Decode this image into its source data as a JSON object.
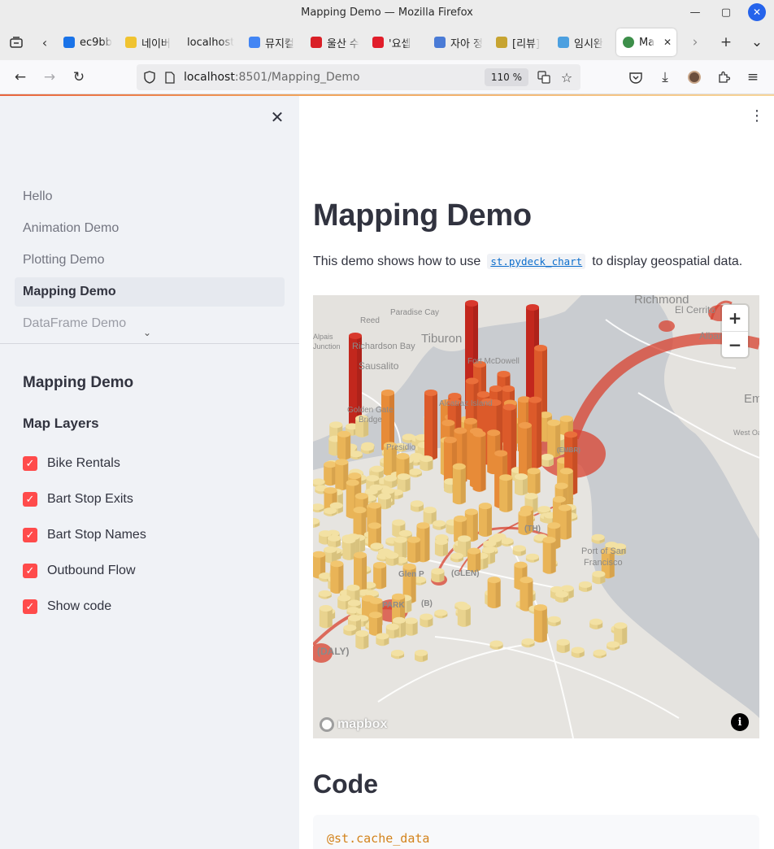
{
  "window": {
    "title": "Mapping Demo — Mozilla Firefox"
  },
  "tabs": [
    {
      "label": "ec9bb",
      "favicon_color": "#1a73e8",
      "icon": "search-icon"
    },
    {
      "label": "네이버",
      "favicon_color": "#f0c330",
      "icon": "naver-icon"
    },
    {
      "label": "localhost",
      "favicon_color": "",
      "icon": ""
    },
    {
      "label": "뮤지컬",
      "favicon_color": "#4285f4",
      "icon": "google-icon"
    },
    {
      "label": "울산 수",
      "favicon_color": "#d91f26",
      "icon": "swoosh-icon"
    },
    {
      "label": "'요셉",
      "favicon_color": "#e11d2a",
      "icon": "flag-icon"
    },
    {
      "label": "자아 정",
      "favicon_color": "#4a7bd6",
      "icon": "doc-icon"
    },
    {
      "label": "[리뷰]",
      "favicon_color": "#c7a431",
      "icon": "bookmark-icon"
    },
    {
      "label": "임시완",
      "favicon_color": "#4ca0e0",
      "icon": "cloud-icon"
    },
    {
      "label": "Ma",
      "favicon_color": "#3d8f4a",
      "icon": "globe-icon",
      "active": true
    }
  ],
  "navbar": {
    "url_host": "localhost",
    "url_rest": ":8501/Mapping_Demo",
    "zoom": "110 %"
  },
  "sidebar": {
    "nav_items": [
      {
        "label": "Hello"
      },
      {
        "label": "Animation Demo"
      },
      {
        "label": "Plotting Demo"
      },
      {
        "label": "Mapping Demo"
      },
      {
        "label": "DataFrame Demo"
      }
    ],
    "section_title": "Mapping Demo",
    "layers_title": "Map Layers",
    "layers": [
      {
        "label": "Bike Rentals",
        "checked": true
      },
      {
        "label": "Bart Stop Exits",
        "checked": true
      },
      {
        "label": "Bart Stop Names",
        "checked": true
      },
      {
        "label": "Outbound Flow",
        "checked": true
      },
      {
        "label": "Show code",
        "checked": true
      }
    ]
  },
  "main": {
    "title": "Mapping Demo",
    "desc_before": "This demo shows how to use",
    "desc_code": "st.pydeck_chart",
    "desc_after": "to display geospatial data.",
    "code_title": "Code",
    "code_first_line": "@st.cache_data"
  },
  "map": {
    "places": [
      "Richmond",
      "Paradise Cay",
      "Reed",
      "Tiburon",
      "Richardson Bay",
      "Sausalito",
      "Fort McDowell",
      "Golden Gate",
      "Bridge",
      "Alcatraz Island",
      "Port of San",
      "Francisco",
      "El Cerrito",
      "Albany",
      "Emeryville",
      "West Oakland",
      "Junction",
      "Alpais",
      "(DALY)",
      "(EMBR)",
      "(GLEN)",
      "Glen P",
      "PARK",
      "(B)",
      "(TH)",
      "Presidio"
    ],
    "attribution": "mapbox"
  },
  "colors": {
    "accent": "#ff4b4b",
    "text": "#31333f",
    "sidebar_bg": "#f0f2f6",
    "code_link": "#0d6ecd",
    "code_decorator": "#d3831c"
  }
}
